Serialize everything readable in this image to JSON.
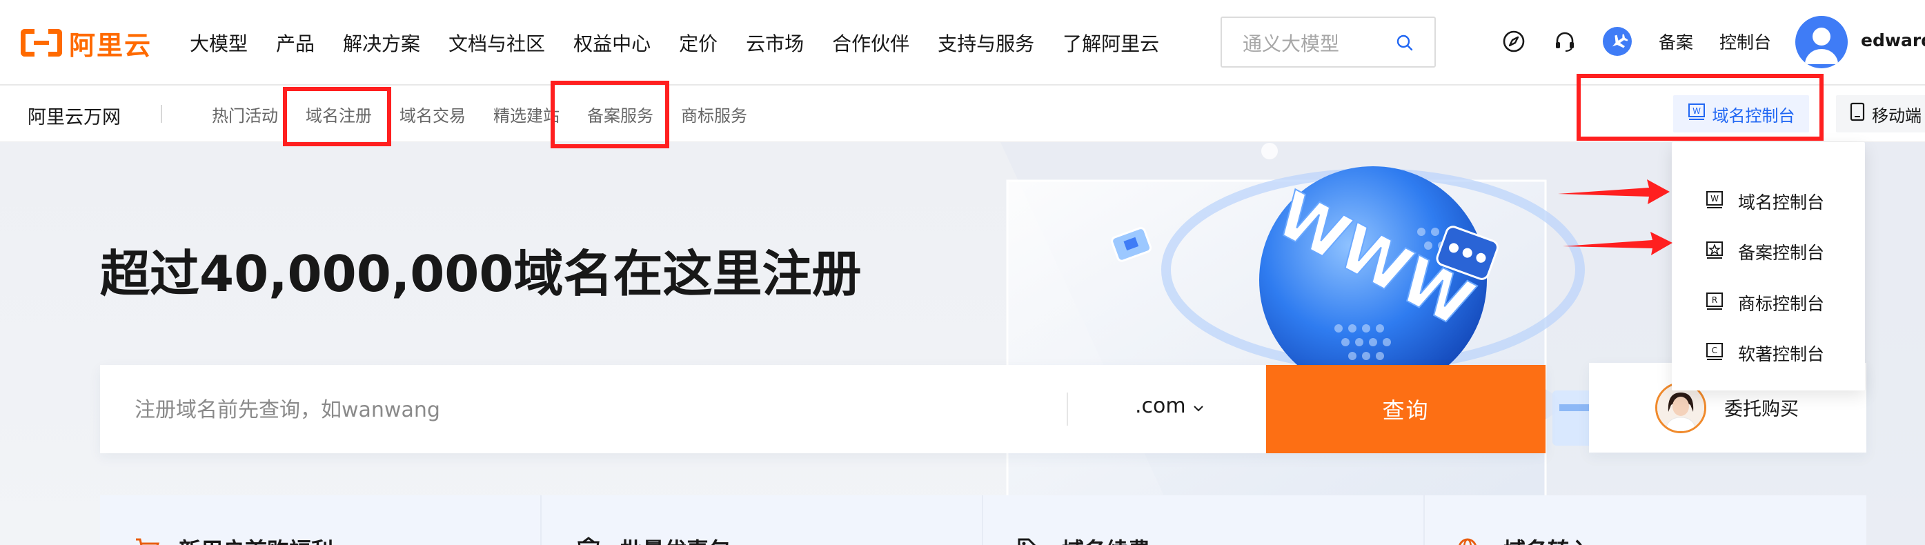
{
  "brand": {
    "logo_text": "阿里云",
    "accent": "#ff6a00"
  },
  "header": {
    "nav": [
      "大模型",
      "产品",
      "解决方案",
      "文档与社区",
      "权益中心",
      "定价",
      "云市场",
      "合作伙伴",
      "支持与服务",
      "了解阿里云"
    ],
    "search": {
      "placeholder": "通义大模型",
      "icon": "search-icon"
    },
    "icons": [
      "compass-icon",
      "headset-icon",
      "plane-icon"
    ],
    "links": {
      "record": "备案",
      "console": "控制台"
    },
    "user": {
      "name": "edward."
    }
  },
  "subnav": {
    "title": "阿里云万网",
    "items": [
      "热门活动",
      "域名注册",
      "域名交易",
      "精选建站",
      "备案服务",
      "商标服务"
    ],
    "console_button": "域名控制台",
    "mobile_button": "移动端"
  },
  "hero": {
    "title": "超过40,000,000域名在这里注册",
    "search": {
      "placeholder": "注册域名前先查询，如wanwang",
      "tld": ".com",
      "button": "查询"
    },
    "delegate": "委托购买"
  },
  "dropdown": {
    "items": [
      {
        "label": "域名控制台",
        "icon": "domain-console-icon"
      },
      {
        "label": "备案控制台",
        "icon": "record-console-icon"
      },
      {
        "label": "商标控制台",
        "icon": "trademark-console-icon"
      },
      {
        "label": "软著控制台",
        "icon": "copyright-console-icon"
      }
    ]
  },
  "promos": [
    "新用户首购福利",
    "批量优惠包",
    "域名续费",
    "域名转入"
  ],
  "colors": {
    "query_button": "#fd6f14",
    "link_blue": "#2167f3",
    "annotation_red": "#ff1f1f"
  }
}
